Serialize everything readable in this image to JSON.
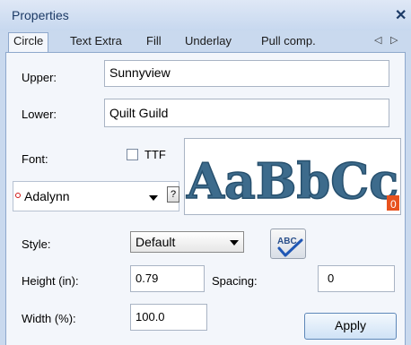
{
  "window": {
    "title": "Properties",
    "close_glyph": "✕"
  },
  "tabs": [
    {
      "label": "Circle",
      "active": true
    },
    {
      "label": "Text Extra",
      "active": false
    },
    {
      "label": "Fill",
      "active": false
    },
    {
      "label": "Underlay",
      "active": false
    },
    {
      "label": "Pull comp.",
      "active": false
    }
  ],
  "tab_nav": {
    "prev": "◁",
    "next": "▷"
  },
  "upper": {
    "label": "Upper:",
    "value": "Sunnyview"
  },
  "lower": {
    "label": "Lower:",
    "value": "Quilt Guild"
  },
  "font": {
    "label": "Font:",
    "ttf_label": "TTF",
    "ttf_checked": false,
    "selected": "Adalynn",
    "help_glyph": "?",
    "preview_text": "AaBbCc",
    "preview_badge": "0",
    "preview_color": "#3d6b8c"
  },
  "style": {
    "label": "Style:",
    "value": "Default",
    "spell_text": "ABC"
  },
  "height": {
    "label": "Height (in):",
    "value": "0.79"
  },
  "spacing": {
    "label": "Spacing:",
    "value": "0"
  },
  "width": {
    "label": "Width (%):",
    "value": "100.0"
  },
  "apply_label": "Apply"
}
